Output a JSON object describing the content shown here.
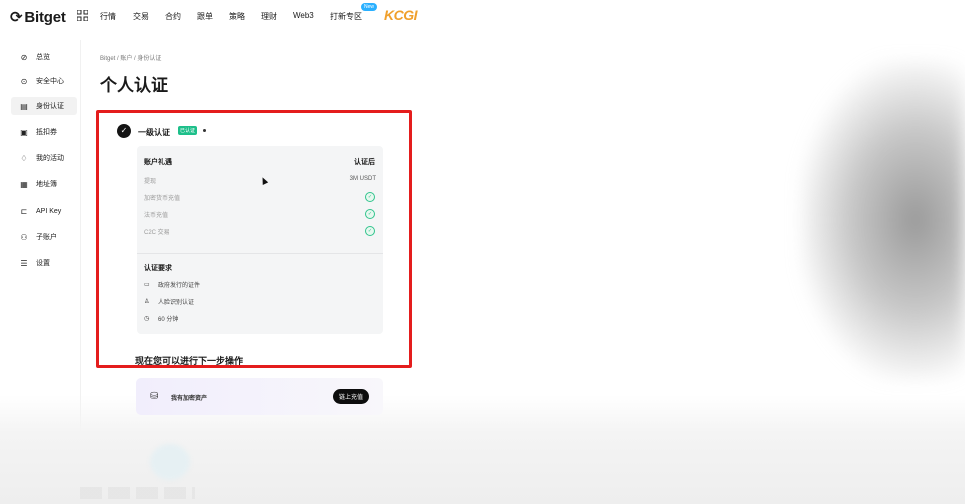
{
  "brand": {
    "logo_text": "Bitget",
    "promo_text": "KCGI"
  },
  "topnav": {
    "items": [
      "行情",
      "交易",
      "合约",
      "跟单",
      "策略",
      "理财",
      "Web3",
      "打新专区"
    ],
    "new_badge": "New"
  },
  "sidebar": {
    "items": [
      {
        "label": "总览",
        "icon": "overview-icon"
      },
      {
        "label": "安全中心",
        "icon": "shield-icon"
      },
      {
        "label": "身份认证",
        "icon": "id-card-icon",
        "active": true
      },
      {
        "label": "抵扣券",
        "icon": "coupon-icon"
      },
      {
        "label": "我的活动",
        "icon": "gift-icon"
      },
      {
        "label": "地址簿",
        "icon": "address-book-icon"
      },
      {
        "label": "API Key",
        "icon": "api-icon"
      },
      {
        "label": "子账户",
        "icon": "sub-account-icon"
      },
      {
        "label": "设置",
        "icon": "settings-icon"
      }
    ]
  },
  "breadcrumb": "Bitget  /  账户  /  身份认证",
  "page_title": "个人认证",
  "verification": {
    "level_label": "一级认证",
    "status_badge": "已认证",
    "card": {
      "header_left": "账户礼遇",
      "header_right": "认证后",
      "rows": [
        {
          "label": "提现",
          "value": "3M USDT"
        },
        {
          "label": "加密货币充值",
          "value": ""
        },
        {
          "label": "法币充值",
          "value": ""
        },
        {
          "label": "C2C 交易",
          "value": ""
        }
      ],
      "requirements_title": "认证要求",
      "requirements": [
        {
          "icon": "document-icon",
          "text": "政府发行的证件"
        },
        {
          "icon": "face-id-icon",
          "text": "人脸识别认证"
        },
        {
          "icon": "clock-icon",
          "text": "60 分钟"
        }
      ]
    }
  },
  "next_step": {
    "heading": "现在您可以进行下一步操作",
    "deposit_label": "我有加密资产",
    "deposit_button": "链上充值"
  },
  "colors": {
    "highlight_frame": "#e41d1d",
    "verified_badge": "#1dbf8a",
    "promo": "#f0a02c"
  }
}
